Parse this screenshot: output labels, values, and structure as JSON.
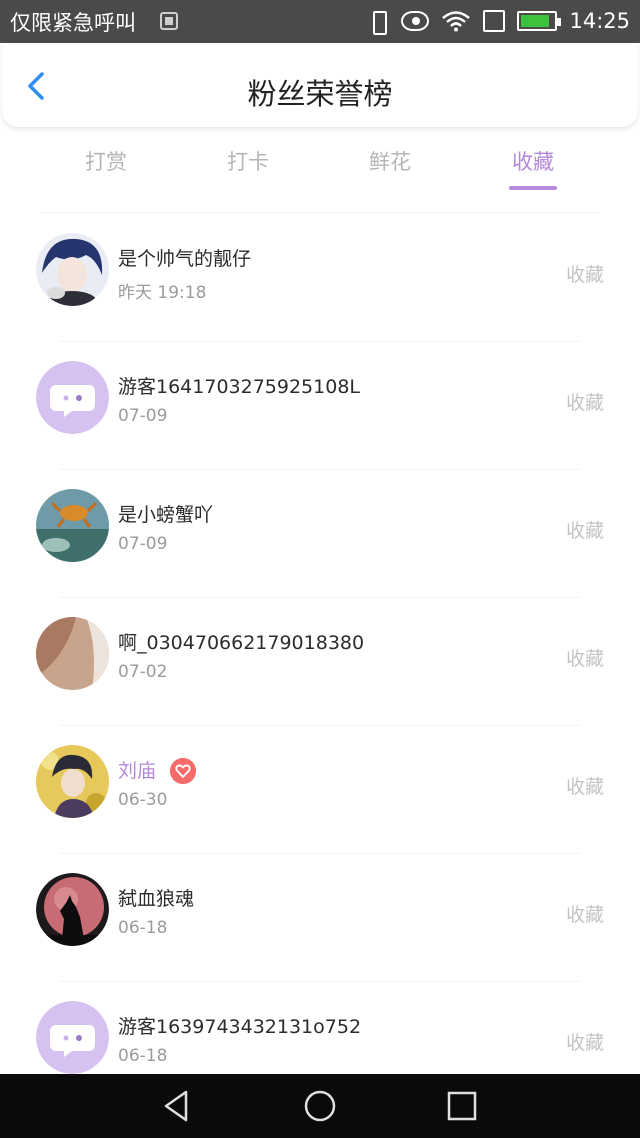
{
  "status_bar": {
    "carrier": "仅限紧急呼叫",
    "time": "14:25"
  },
  "header": {
    "title": "粉丝荣誉榜"
  },
  "tabs": [
    {
      "label": "打赏",
      "active": false
    },
    {
      "label": "打卡",
      "active": false
    },
    {
      "label": "鲜花",
      "active": false
    },
    {
      "label": "收藏",
      "active": true
    }
  ],
  "colors": {
    "accent": "#b588d9",
    "muted": "#c4c4c4",
    "badge": "#f76a6a"
  },
  "fans": [
    {
      "name": "是个帅气的靓仔",
      "date": "昨天 19:18",
      "action": "收藏",
      "avatar": "anime-blue-hair-avatar"
    },
    {
      "name": "游客1641703275925108L",
      "date": "07-09",
      "action": "收藏",
      "avatar": "default-chat-avatar"
    },
    {
      "name": "是小螃蟹吖",
      "date": "07-09",
      "action": "收藏",
      "avatar": "crab-photo-avatar"
    },
    {
      "name": "啊_030470662179018380",
      "date": "07-02",
      "action": "收藏",
      "avatar": "beige-photo-avatar"
    },
    {
      "name": "刘庙",
      "date": "06-30",
      "action": "收藏",
      "avatar": "anime-character-avatar",
      "vip": true
    },
    {
      "name": "弑血狼魂",
      "date": "06-18",
      "action": "收藏",
      "avatar": "wolf-moon-avatar"
    },
    {
      "name": "游客1639743432131o752",
      "date": "06-18",
      "action": "收藏",
      "avatar": "default-chat-avatar"
    }
  ]
}
